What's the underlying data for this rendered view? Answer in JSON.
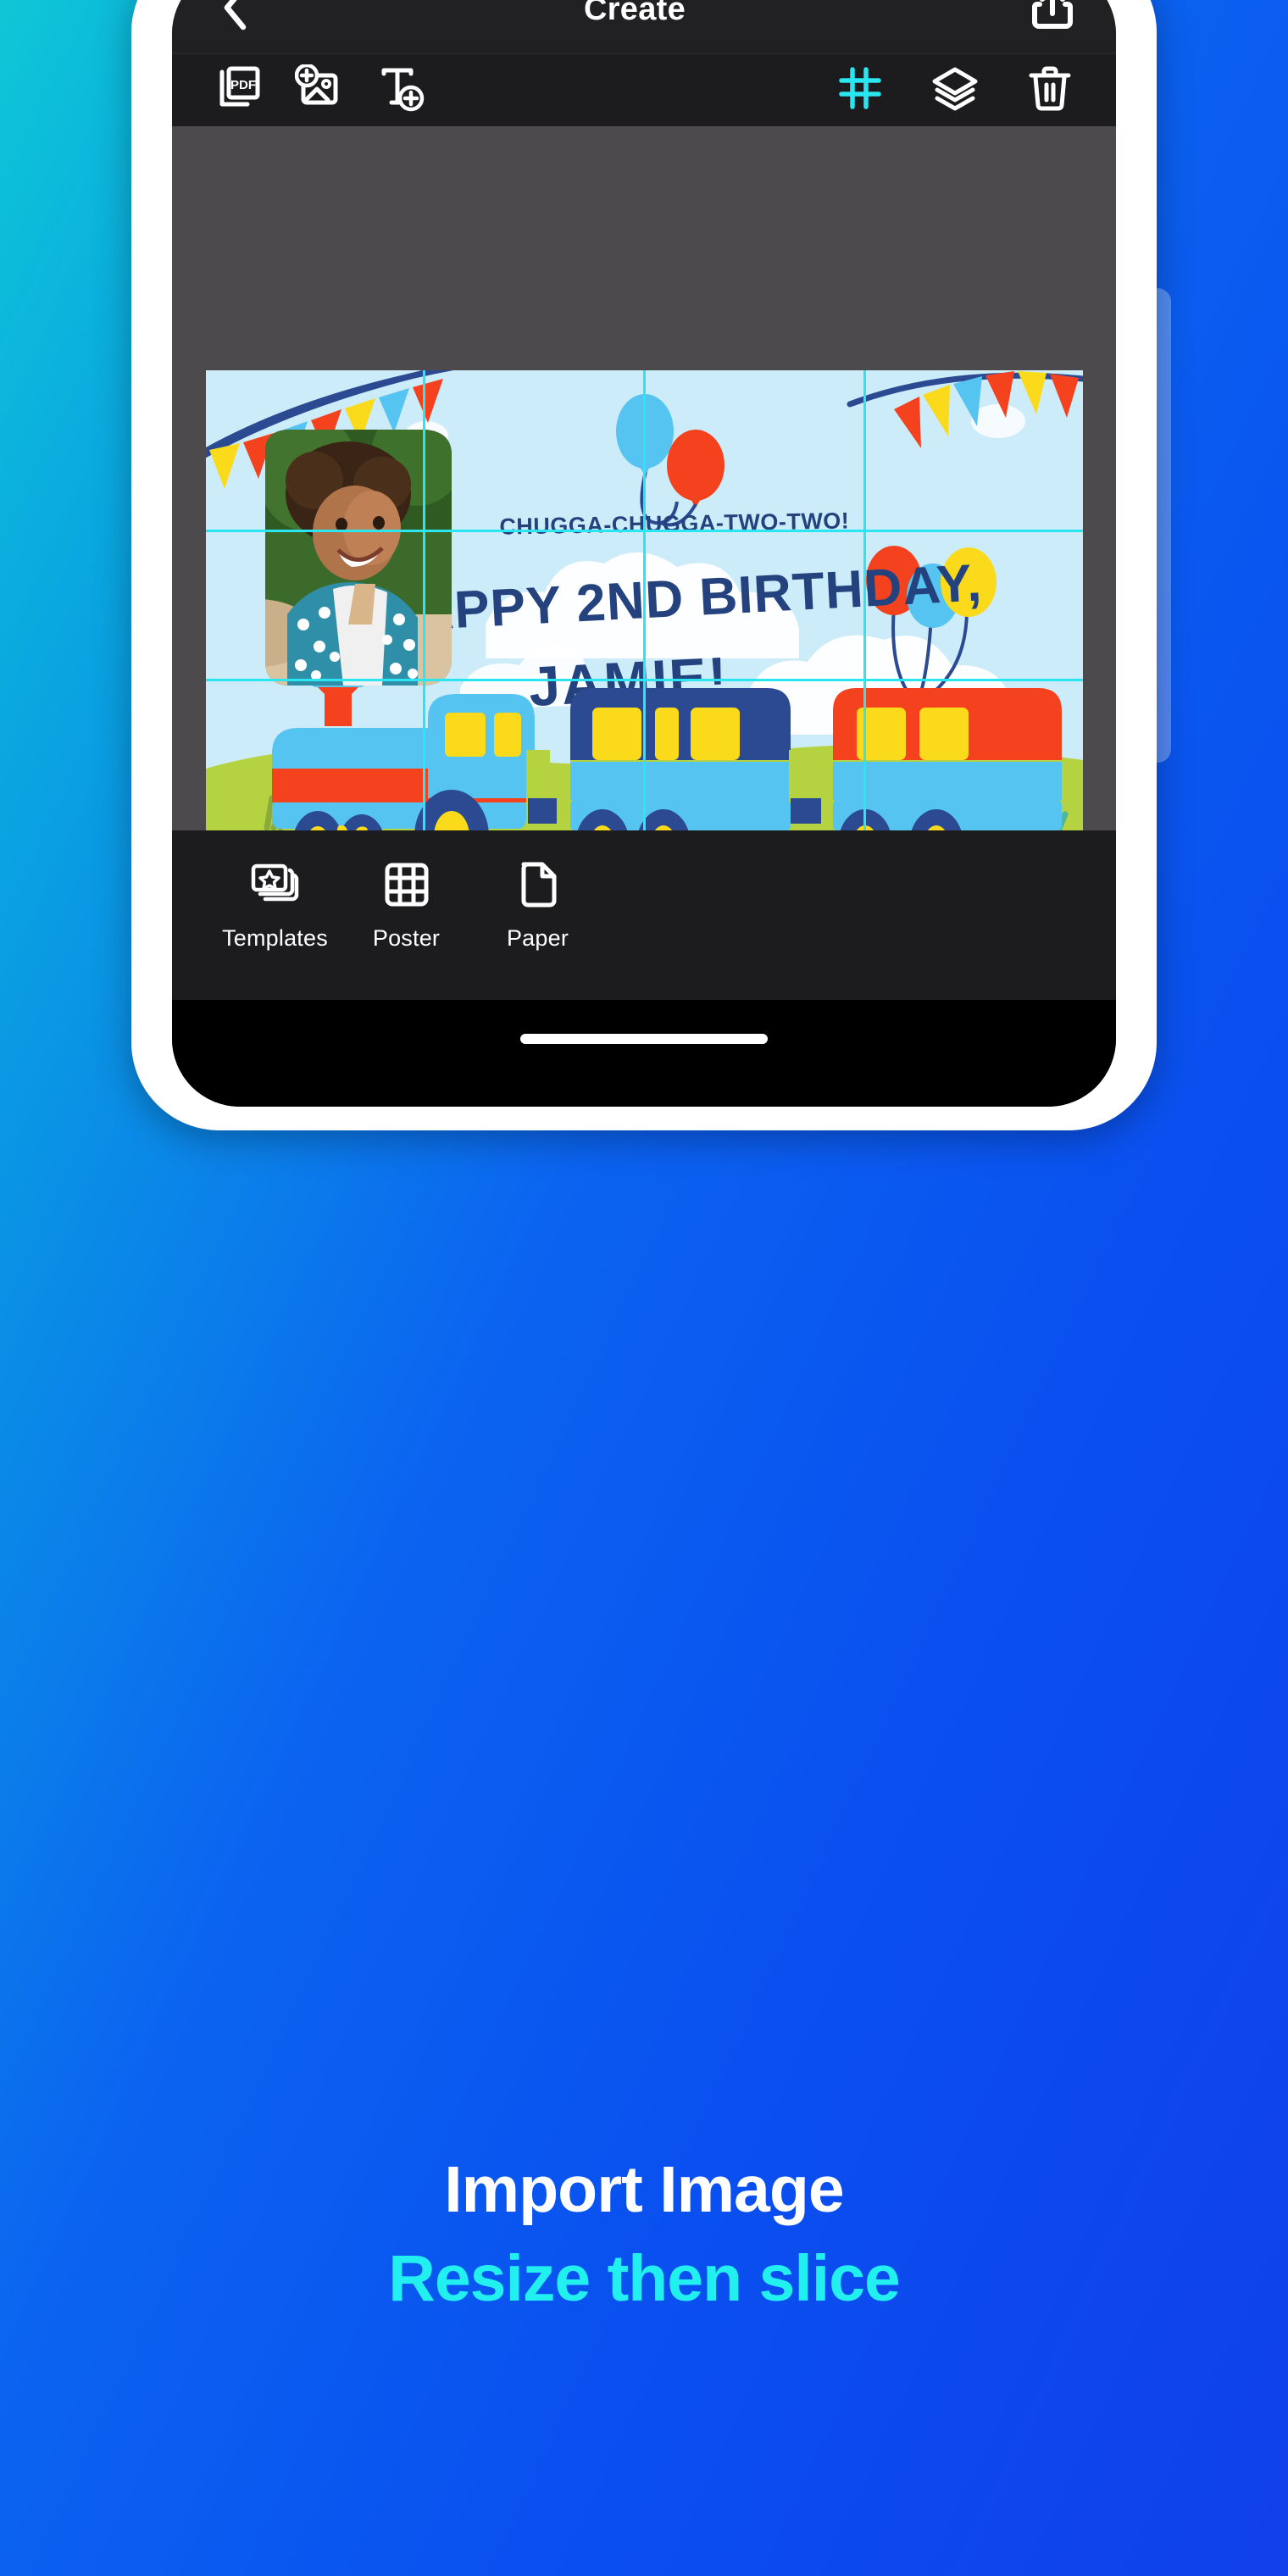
{
  "header": {
    "title": "Create",
    "back_icon": "chevron-left-icon",
    "share_icon": "share-upload-icon"
  },
  "toolbar": {
    "left_tools": [
      {
        "name": "pdf-tool",
        "icon": "pdf-document-icon",
        "label": "PDF"
      },
      {
        "name": "add-image-tool",
        "icon": "add-image-icon",
        "label": "Add Image"
      },
      {
        "name": "add-text-tool",
        "icon": "add-text-icon",
        "label": "Add Text"
      }
    ],
    "right_tools": [
      {
        "name": "grid-tool",
        "icon": "grid-icon",
        "label": "Grid",
        "active": true,
        "color": "#29e6f0"
      },
      {
        "name": "layers-tool",
        "icon": "layers-icon",
        "label": "Layers",
        "active": false,
        "color": "#ffffff"
      },
      {
        "name": "delete-tool",
        "icon": "trash-icon",
        "label": "Delete",
        "active": false,
        "color": "#ffffff"
      }
    ]
  },
  "canvas": {
    "background": "#4c4a4c",
    "grid_color": "#29e6f0",
    "grid_columns": 4,
    "grid_rows": 3,
    "artwork": {
      "sky_color": "#cdecfa",
      "grass_color": "#b5d341",
      "headline_small": "CHUGGA-CHUGGA-TWO-TWO!",
      "headline_main": "HAPPY 2ND BIRTHDAY,",
      "headline_name": "JAMIE!",
      "text_color": "#24427e",
      "bunting_colors": [
        "#fada1a",
        "#f4421f",
        "#56c4f0"
      ],
      "balloon_colors": [
        "#56c4f0",
        "#f4421f",
        "#fada1a"
      ],
      "train_colors": {
        "engine_body": "#f4421f",
        "cab": "#56c4f0",
        "car_navy": "#2b4a91",
        "car_red": "#f4421f",
        "window": "#fada1a",
        "wheel": "#2b4a91",
        "trim": "#b5d341"
      },
      "gift_colors": [
        "#56c4f0",
        "#f4421f",
        "#fada1a",
        "#2b4a91"
      ]
    }
  },
  "bottom_bar": {
    "items": [
      {
        "name": "templates-tab",
        "icon": "templates-stack-icon",
        "label": "Templates"
      },
      {
        "name": "poster-tab",
        "icon": "grid-3x3-icon",
        "label": "Poster"
      },
      {
        "name": "paper-tab",
        "icon": "paper-document-icon",
        "label": "Paper"
      }
    ],
    "add_button": {
      "name": "add-button",
      "icon": "plus-icon",
      "label": "+"
    }
  },
  "promo": {
    "line1": "Import Image",
    "line2": "Resize then slice",
    "line1_color": "#ffffff",
    "line2_color": "#22f0f0"
  }
}
